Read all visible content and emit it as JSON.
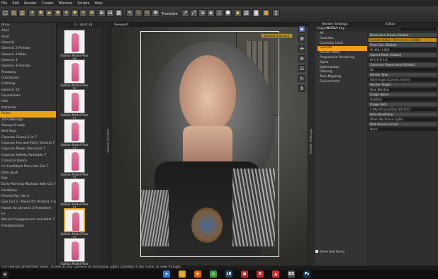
{
  "menu": [
    "File",
    "Edit",
    "Render",
    "Create",
    "Window",
    "Scripts",
    "Help"
  ],
  "toolbar": {
    "translate_label": "Translate"
  },
  "left_tree": {
    "items": [
      "Anny",
      "Aspt",
      "Acke",
      "Genesis",
      "Genesis 2 Female",
      "Genesis 2 Male",
      "Genesis 3",
      "Genesis 3 Female",
      "Anatomy",
      "Characters",
      "Clothing",
      "Genesis 10",
      "Expressions",
      "Hair",
      "Materials",
      "Poses",
      "3D-G8Design",
      "Always-A-Lady",
      "Bed Yoga",
      "Capsces Classy 5-in-7",
      "Capsces Fun and Flirty Victoria 7",
      "Capsces Power Teen Jose 7",
      "Capsces Variety Available 7",
      "Classical Dance",
      "Co-Confident Poses for Gia 7",
      "Dark Spell",
      "Dirt",
      "Early Morning Workout with Gia 7",
      "FeralFeny",
      "Friends For Life 2",
      "Gun Girl 2 - Poses for Victoria 7 and 7...",
      "Hands for Genesis 3 Female(s)",
      "Hi",
      "Nociant Sanguine for Available 7",
      "PredatorGlass"
    ],
    "selected_index": 15
  },
  "thumbs": {
    "header": "1 - 28 of 28",
    "items": [
      {
        "label": "Fashion Model Pose 09"
      },
      {
        "label": "Fashion Model Pose 10"
      },
      {
        "label": "Fashion Model Pose 11"
      },
      {
        "label": "Fashion Model Pose 12"
      },
      {
        "label": "Fashion Model Pose 13"
      },
      {
        "label": "Fashion Model Pose 14"
      },
      {
        "label": "Fashion Model Pose 15"
      },
      {
        "label": "Fashion Model Pose 16"
      }
    ],
    "selected_index": 6
  },
  "viewport": {
    "tab": "Viewport",
    "camera": "Default Camera"
  },
  "side_tabs": {
    "left": "Smart Content",
    "right": "Render Settings"
  },
  "render": {
    "tabs": [
      "Render Settings",
      "Editor"
    ],
    "engine_label": "Engine",
    "engine_value": "NVIDIA Iray",
    "search_placeholder": "",
    "nav": [
      "All",
      "Favorites",
      "Currently Used",
      "General",
      "Render Mode",
      "Progressive Rendering",
      "Alpha",
      "Optimization",
      "Filtering",
      "Tone Mapping",
      "Environment"
    ],
    "nav_selected_index": 3,
    "props": [
      {
        "t": "Dimension Preset (Global)",
        "k": "hdr"
      },
      {
        "t": "Custom Ratio : Portrait (1:1.6180)",
        "k": "orange"
      },
      {
        "t": "Pixel Size (Global)",
        "k": "hdr"
      },
      {
        "t": "W      494          H      800",
        "k": "fld"
      },
      {
        "t": "Aspect Ratio (Global)",
        "k": "hdr"
      },
      {
        "t": "W      1.0          H      1.6",
        "k": "fld"
      },
      {
        "t": "Constrain Proportions (Global)",
        "k": "hdr"
      },
      {
        "t": "On",
        "k": "fld"
      },
      {
        "t": "Render Type",
        "k": "hdr"
      },
      {
        "t": "Still Image (Current Frame)",
        "k": "fld"
      },
      {
        "t": "Render Target",
        "k": "hdr"
      },
      {
        "t": "New Window",
        "k": "fld"
      },
      {
        "t": "Image Name",
        "k": "hdr"
      },
      {
        "t": "Untitled",
        "k": "fld"
      },
      {
        "t": "Image Path",
        "k": "hdr"
      },
      {
        "t": "F:/My Pictures/Daz 3D/TEST",
        "k": "fld"
      },
      {
        "t": "Auto Headlamp",
        "k": "hdr"
      },
      {
        "t": "When No Scene Lights",
        "k": "fld"
      },
      {
        "t": "Post Process Script",
        "k": "hdr"
      },
      {
        "t": "None",
        "k": "fld"
      }
    ],
    "show_sub_items": "Show Sub Items"
  },
  "status_text": "Ctrl+Render predefined Views, as well as any Cameras or directional Lights currently in the scene, to view through.",
  "taskbar": {
    "icons": [
      {
        "name": "edge-icon",
        "glyph": "e",
        "color": "#2d7dd2"
      },
      {
        "name": "explorer-icon",
        "glyph": "▭",
        "color": "#d9a520"
      },
      {
        "name": "firefox-icon",
        "glyph": "◉",
        "color": "#e66000"
      },
      {
        "name": "chrome-icon",
        "glyph": "◎",
        "color": "#3a9b3a"
      },
      {
        "name": "lightroom-icon",
        "glyph": "LR",
        "color": "#2b4a6a"
      },
      {
        "name": "app-icon",
        "glyph": "▣",
        "color": "#b03030"
      },
      {
        "name": "k-icon",
        "glyph": "K",
        "color": "#c02a2a"
      },
      {
        "name": "app2-icon",
        "glyph": "▲",
        "color": "#cc3333"
      },
      {
        "name": "daz-icon",
        "glyph": "DS",
        "color": "#555"
      },
      {
        "name": "photoshop-icon",
        "glyph": "Ps",
        "color": "#123a5a"
      }
    ]
  }
}
